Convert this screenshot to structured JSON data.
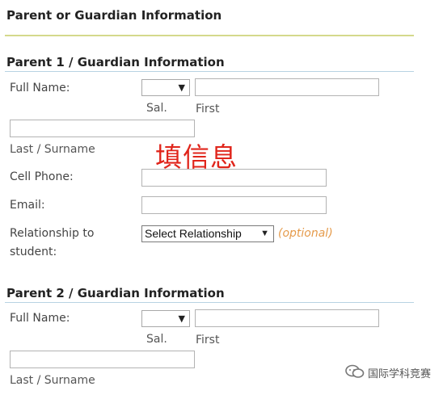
{
  "header": {
    "title": "Parent or Guardian Information"
  },
  "parent1": {
    "title": "Parent 1 / Guardian Information",
    "full_name_label": "Full Name:",
    "sal_label": "Sal.",
    "first_label": "First",
    "last_label": "Last / Surname",
    "cell_label": "Cell Phone:",
    "email_label": "Email:",
    "relationship_label_1": "Relationship to",
    "relationship_label_2": "student:",
    "relationship_value": "Select Relationship",
    "optional": "(optional)"
  },
  "parent2": {
    "title": "Parent 2 / Guardian Information",
    "full_name_label": "Full Name:",
    "sal_label": "Sal.",
    "first_label": "First",
    "last_label": "Last / Surname"
  },
  "annotation": "填信息",
  "watermark": "国际学科竞赛",
  "icons": {
    "dropdown": "▼",
    "watermark_icon": "chat-bubbles-icon"
  }
}
